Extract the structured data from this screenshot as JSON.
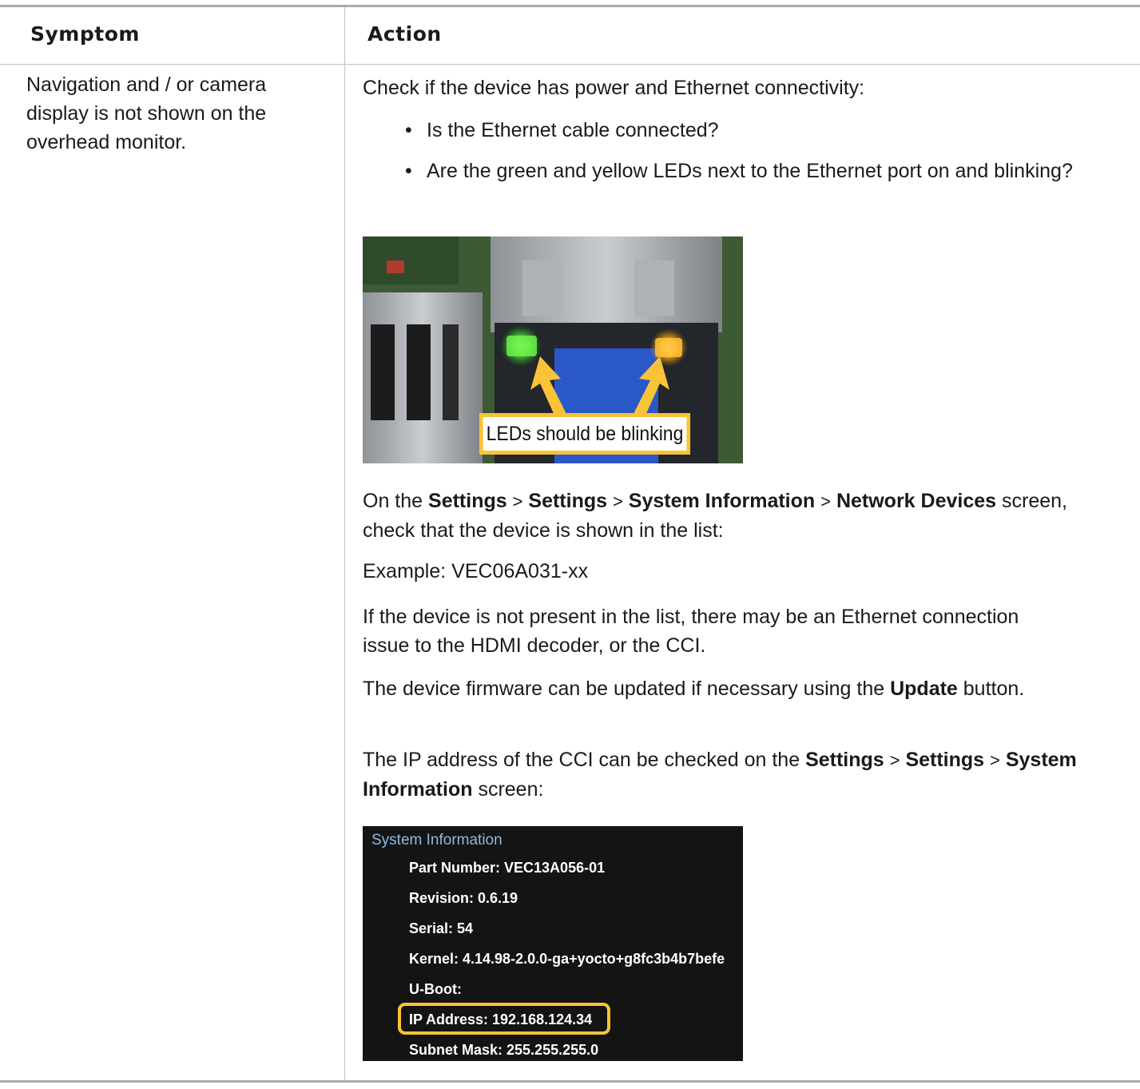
{
  "table": {
    "headers": {
      "symptom": "Symptom",
      "action": "Action"
    },
    "row": {
      "symptom": "Navigation and / or camera display is not shown on the overhead monitor.",
      "action": {
        "intro": "Check if the device has power and Ethernet connectivity:",
        "bullets": [
          "Is the Ethernet cable connected?",
          "Are the green and yellow LEDs next to the Ethernet port on and blinking?"
        ],
        "photo_caption": "LEDs should be blinking",
        "nav_path": {
          "prefix": "On the",
          "steps": [
            "Settings",
            "Settings",
            "System Information",
            "Network Devices"
          ],
          "separator": ">",
          "suffix": "screen, check that the device is shown in the list:"
        },
        "example": "Example: VEC06A031-xx",
        "not_present_note": "If the device is not present in the list, there may be an Ethernet connection issue to the HDMI decoder, or the CCI.",
        "update_note": {
          "prefix": "The device firmware can be updated if necessary using the",
          "button": "Update",
          "suffix": "button."
        },
        "ip_note": {
          "prefix": "The IP address of the CCI can be checked on the",
          "steps": [
            "Settings",
            "Settings",
            "System Information"
          ],
          "separator": ">",
          "suffix": "screen:"
        },
        "system_info": {
          "title": "System Information",
          "lines": [
            "Part Number: VEC13A056-01",
            "Revision: 0.6.19",
            "Serial: 54",
            "Kernel: 4.14.98-2.0.0-ga+yocto+g8fc3b4b7befe",
            "U-Boot:",
            "IP Address: 192.168.124.34",
            "Subnet Mask: 255.255.255.0"
          ],
          "highlighted_line_index": 5
        }
      }
    }
  },
  "colors": {
    "highlight": "#f8c336",
    "led_green": "#57e03a",
    "led_yellow": "#ffb21e",
    "sysinfo_title": "#8fb9dc",
    "sysinfo_bg": "#141414"
  }
}
